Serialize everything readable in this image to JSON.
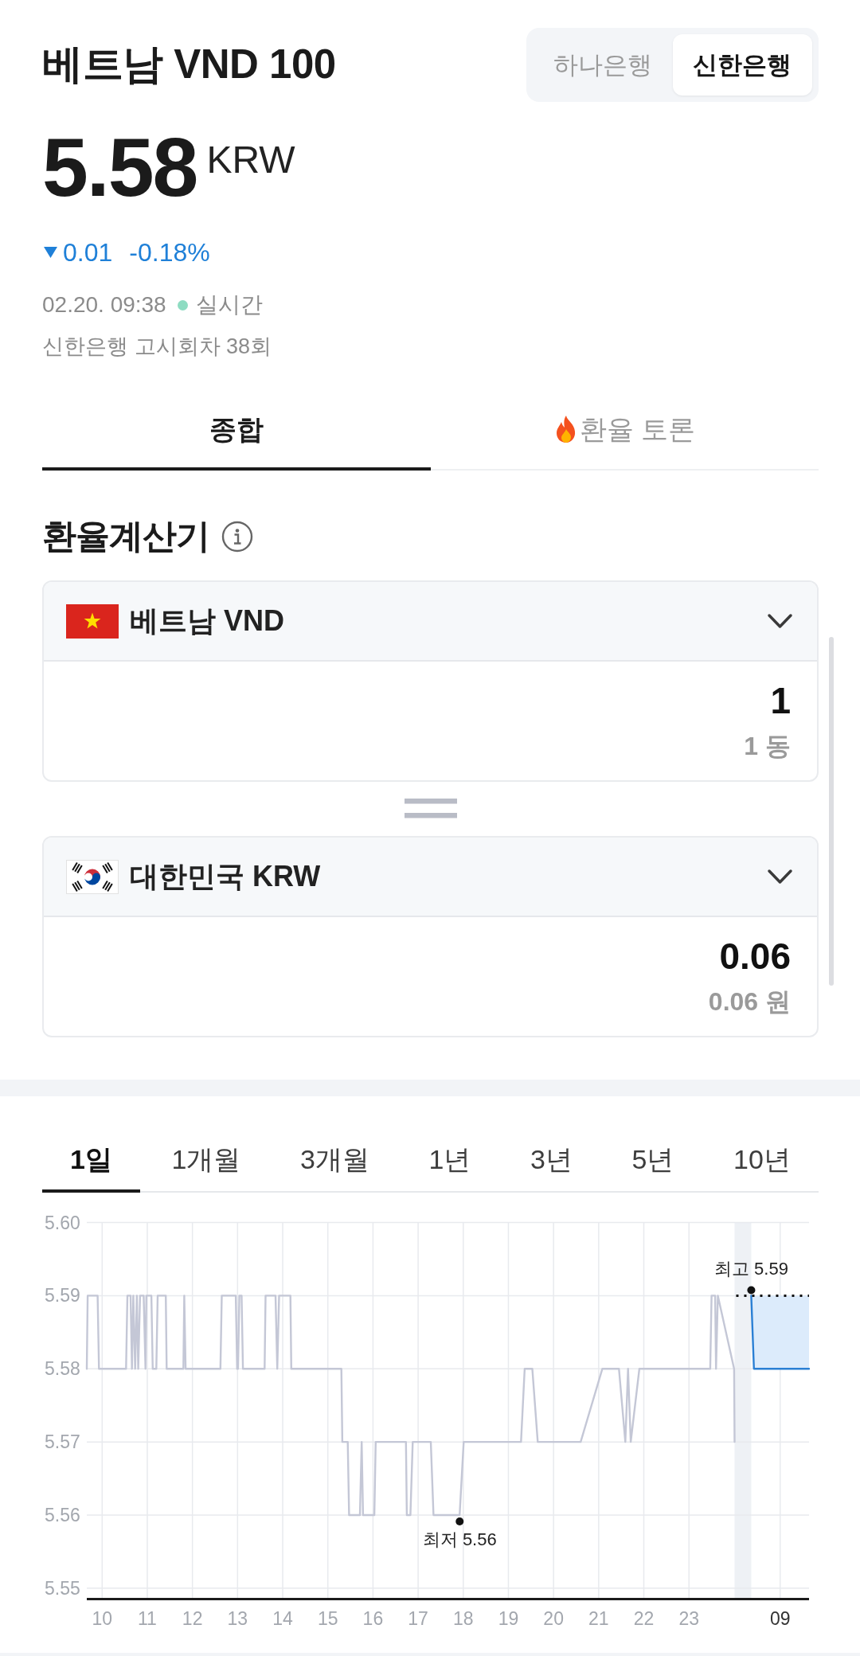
{
  "header": {
    "title": "베트남 VND 100",
    "bank_tabs": [
      {
        "label": "하나은행",
        "selected": false
      },
      {
        "label": "신한은행",
        "selected": true
      }
    ]
  },
  "quote": {
    "price": "5.58",
    "unit": "KRW",
    "change": {
      "down": true,
      "amount": "0.01",
      "percent": "-0.18%"
    },
    "timestamp": "02.20. 09:38",
    "live": {
      "on": true,
      "label": "실시간"
    },
    "notice_round": "신한은행 고시회차 38회"
  },
  "tabs": [
    {
      "label": "종합",
      "selected": true,
      "kind": "text"
    },
    {
      "label": "환율 토론",
      "selected": false,
      "kind": "hot"
    }
  ],
  "calculator": {
    "title": "환율계산기",
    "currencies": [
      {
        "name": "베트남 VND",
        "amount": "1",
        "amount_text": "1 동"
      },
      {
        "name": "대한민국 KRW",
        "amount": "0.06",
        "amount_text": "0.06 원"
      }
    ]
  },
  "chart": {
    "periods": [
      {
        "label": "1일",
        "selected": true
      },
      {
        "label": "1개월",
        "selected": false
      },
      {
        "label": "3개월",
        "selected": false
      },
      {
        "label": "1년",
        "selected": false
      },
      {
        "label": "3년",
        "selected": false
      },
      {
        "label": "5년",
        "selected": false
      },
      {
        "label": "10년",
        "selected": false
      }
    ],
    "chart_data": {
      "type": "line",
      "grid": true,
      "x": [
        9.66,
        9.68,
        9.9,
        9.93,
        10.53,
        10.56,
        10.63,
        10.66,
        10.69,
        10.73,
        10.77,
        10.8,
        10.84,
        10.92,
        10.96,
        10.98,
        11.09,
        11.12,
        11.2,
        11.23,
        11.41,
        11.43,
        11.8,
        11.82,
        11.85,
        12.62,
        12.65,
        12.96,
        12.99,
        13.01,
        13.04,
        13.09,
        13.12,
        13.6,
        13.62,
        13.84,
        13.88,
        13.92,
        14.17,
        14.19,
        15.3,
        15.32,
        15.44,
        15.47,
        15.71,
        15.75,
        15.78,
        16.03,
        16.06,
        16.73,
        16.75,
        16.83,
        16.88,
        17.28,
        17.34,
        17.92,
        18.01,
        19.28,
        19.36,
        19.53,
        19.65,
        20.6,
        21.08,
        21.45,
        21.59,
        21.65,
        21.71,
        21.9,
        23.47,
        23.5,
        23.58,
        23.6,
        23.64,
        24.0,
        24.01,
        24.38,
        24.44,
        25.66
      ],
      "series": [
        {
          "color": "#c4c7d6",
          "values": [
            5.58,
            5.59,
            5.59,
            5.58,
            5.58,
            5.59,
            5.59,
            5.58,
            5.59,
            5.58,
            5.59,
            5.58,
            5.59,
            5.59,
            5.58,
            5.59,
            5.59,
            5.58,
            5.58,
            5.59,
            5.59,
            5.58,
            5.58,
            5.59,
            5.58,
            5.58,
            5.59,
            5.59,
            5.58,
            5.58,
            5.59,
            5.59,
            5.58,
            5.58,
            5.59,
            5.59,
            5.58,
            5.59,
            5.59,
            5.58,
            5.58,
            5.57,
            5.57,
            5.56,
            5.56,
            5.57,
            5.56,
            5.56,
            5.57,
            5.57,
            5.56,
            5.56,
            5.57,
            5.57,
            5.56,
            5.56,
            5.57,
            5.57,
            5.58,
            5.58,
            5.57,
            5.57,
            5.58,
            5.58,
            5.57,
            5.58,
            5.57,
            5.58,
            5.58,
            5.59,
            5.59,
            5.58,
            5.59,
            5.58,
            5.57,
            null,
            null,
            null
          ]
        },
        {
          "color": "#2a7fd4",
          "values": [
            null,
            null,
            null,
            null,
            null,
            null,
            null,
            null,
            null,
            null,
            null,
            null,
            null,
            null,
            null,
            null,
            null,
            null,
            null,
            null,
            null,
            null,
            null,
            null,
            null,
            null,
            null,
            null,
            null,
            null,
            null,
            null,
            null,
            null,
            null,
            null,
            null,
            null,
            null,
            null,
            null,
            null,
            null,
            null,
            null,
            null,
            null,
            null,
            null,
            null,
            null,
            null,
            null,
            null,
            null,
            null,
            null,
            null,
            null,
            null,
            null,
            null,
            null,
            null,
            null,
            null,
            null,
            null,
            null,
            null,
            null,
            null,
            null,
            null,
            null,
            5.59,
            5.58,
            5.58
          ]
        }
      ],
      "xlim": [
        9.66,
        25.66
      ],
      "ylim": [
        5.5485,
        5.6
      ],
      "xticks": [
        10,
        11,
        12,
        13,
        14,
        15,
        16,
        17,
        18,
        19,
        20,
        21,
        22,
        23
      ],
      "yticks": [
        {
          "value": 5.6,
          "label": "5.60"
        },
        5.59,
        5.58,
        5.57,
        5.56,
        5.55
      ],
      "ref_lines": [
        {
          "axis": "y",
          "value": 5.59
        }
      ],
      "annotations": [
        {
          "text": "최고 5.59",
          "x": 24.38,
          "y": 5.59
        },
        {
          "text": "최저 5.56",
          "x": 17.92,
          "y": 5.56
        }
      ]
    },
    "last_session_label": "09"
  }
}
